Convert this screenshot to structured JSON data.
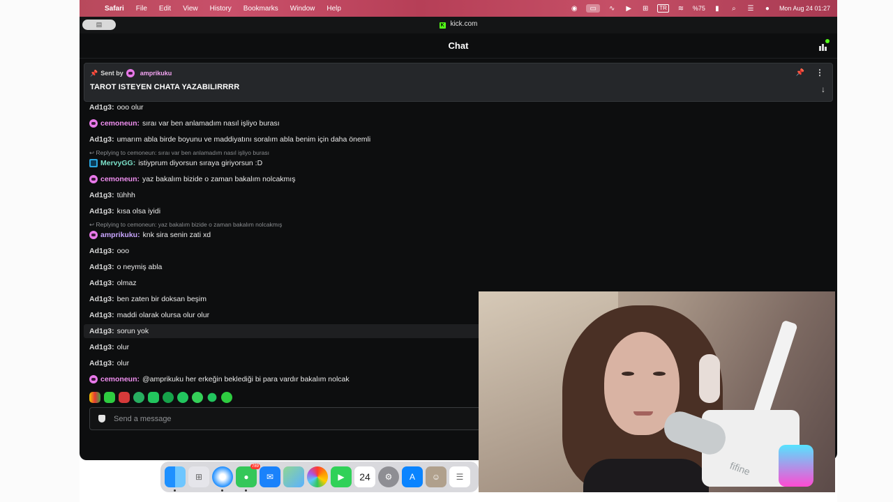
{
  "menubar": {
    "app_name": "Safari",
    "items": [
      "File",
      "Edit",
      "View",
      "History",
      "Bookmarks",
      "Window",
      "Help"
    ],
    "input_source": "TR",
    "battery": "%75",
    "datetime": "Mon Aug 24  01:27"
  },
  "browser": {
    "url": "kick.com"
  },
  "chat": {
    "title": "Chat",
    "pinned": {
      "sent_by_label": "Sent by",
      "sender": "amprikuku",
      "message": "TAROT ISTEYEN CHATA YAZABILIRRRR"
    },
    "messages": [
      {
        "user": "Ad1g3",
        "text": "ooo olur",
        "type": "ad"
      },
      {
        "user": "cemoneun",
        "text": "sıraı var ben anlamadım nasıl işliyo burası",
        "type": "cem",
        "badge": true
      },
      {
        "user": "Ad1g3",
        "text": "umarım abla birde boyunu ve maddiyatını soralım abla benim için daha önemli",
        "type": "ad"
      },
      {
        "user": "MervyGG",
        "text": "istiyprum diyorsun sıraya giriyorsun :D",
        "type": "mer",
        "badge": true,
        "reply": "Replying to cemoneun: sıraı var ben anlamadım nasıl işliyo burası"
      },
      {
        "user": "cemoneun",
        "text": "yaz bakalım bizide o zaman bakalım nolcakmış",
        "type": "cem",
        "badge": true
      },
      {
        "user": "Ad1g3",
        "text": "tühhh",
        "type": "ad"
      },
      {
        "user": "Ad1g3",
        "text": "kısa olsa iyidi",
        "type": "ad"
      },
      {
        "user": "amprikuku",
        "text": "knk sira senin zati xd",
        "type": "amp",
        "badge": true,
        "reply": "Replying to cemoneun: yaz bakalım bizide o zaman bakalım nolcakmış"
      },
      {
        "user": "Ad1g3",
        "text": "ooo",
        "type": "ad"
      },
      {
        "user": "Ad1g3",
        "text": "o neymiş abla",
        "type": "ad"
      },
      {
        "user": "Ad1g3",
        "text": "olmaz",
        "type": "ad"
      },
      {
        "user": "Ad1g3",
        "text": "ben zaten bir doksan beşim",
        "type": "ad"
      },
      {
        "user": "Ad1g3",
        "text": "maddi olarak olursa olur olur",
        "type": "ad"
      },
      {
        "user": "Ad1g3",
        "text": "sorun yok",
        "type": "ad",
        "hover": true
      },
      {
        "user": "Ad1g3",
        "text": "olur",
        "type": "ad"
      },
      {
        "user": "Ad1g3",
        "text": "olur",
        "type": "ad"
      },
      {
        "user": "cemoneun",
        "text": "@amprikuku her erkeğin beklediği bi para vardır bakalım nolcak",
        "type": "cem",
        "badge": true
      }
    ],
    "input_placeholder": "Send a message"
  },
  "webcam": {
    "brand": "fifine"
  },
  "dock": {
    "messages_badge": "789",
    "calendar_day": "24"
  }
}
